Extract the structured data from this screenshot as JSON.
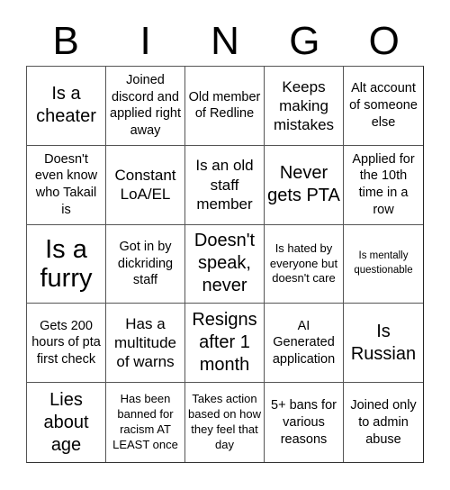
{
  "header": {
    "letters": [
      "B",
      "I",
      "N",
      "G",
      "O"
    ]
  },
  "cells": [
    {
      "text": "Is a cheater",
      "size": "l"
    },
    {
      "text": "Joined discord and applied right away",
      "size": "s"
    },
    {
      "text": "Old member of Redline",
      "size": "s"
    },
    {
      "text": "Keeps making mistakes",
      "size": "m"
    },
    {
      "text": "Alt account of someone else",
      "size": "s"
    },
    {
      "text": "Doesn't even know who Takail is",
      "size": "s"
    },
    {
      "text": "Constant LoA/EL",
      "size": "m"
    },
    {
      "text": "Is an old staff member",
      "size": "m"
    },
    {
      "text": "Never gets PTA",
      "size": "l"
    },
    {
      "text": "Applied for the 10th time in a row",
      "size": "s"
    },
    {
      "text": "Is a furry",
      "size": "xl"
    },
    {
      "text": "Got in by dickriding staff",
      "size": "s"
    },
    {
      "text": "Doesn't speak, never",
      "size": "l"
    },
    {
      "text": "Is hated by everyone but doesn't care",
      "size": "xs"
    },
    {
      "text": "Is mentally questionable",
      "size": "xxs"
    },
    {
      "text": "Gets 200 hours of pta first check",
      "size": "s"
    },
    {
      "text": "Has a multitude of warns",
      "size": "m"
    },
    {
      "text": "Resigns after 1 month",
      "size": "l"
    },
    {
      "text": "AI Generated application",
      "size": "s"
    },
    {
      "text": "Is Russian",
      "size": "l"
    },
    {
      "text": "Lies about age",
      "size": "l"
    },
    {
      "text": "Has been banned for racism AT LEAST once",
      "size": "xs"
    },
    {
      "text": "Takes action based on how they feel that day",
      "size": "xs"
    },
    {
      "text": "5+ bans for various reasons",
      "size": "s"
    },
    {
      "text": "Joined only to admin abuse",
      "size": "s"
    }
  ]
}
